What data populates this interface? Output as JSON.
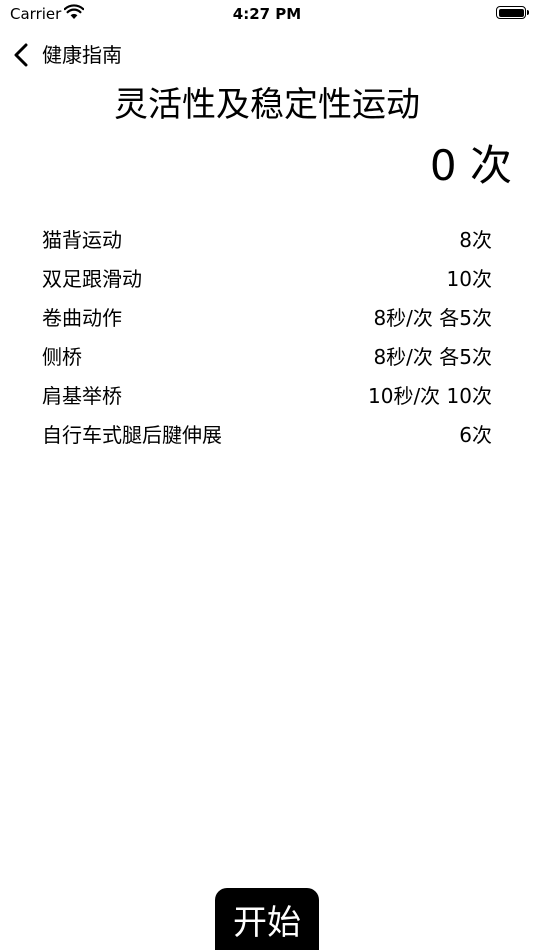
{
  "status_bar": {
    "carrier": "Carrier",
    "time": "4:27 PM",
    "battery_level": 1.0
  },
  "nav": {
    "back_label": "健康指南"
  },
  "title": "灵活性及稳定性运动",
  "count": "0 次",
  "exercises": [
    {
      "name": "猫背运动",
      "reps": "8次"
    },
    {
      "name": "双足跟滑动",
      "reps": "10次"
    },
    {
      "name": "卷曲动作",
      "reps": "8秒/次 各5次"
    },
    {
      "name": "侧桥",
      "reps": "8秒/次 各5次"
    },
    {
      "name": "肩基举桥",
      "reps": "10秒/次 10次"
    },
    {
      "name": "自行车式腿后腱伸展",
      "reps": "6次"
    }
  ],
  "start_button": {
    "label": "开始",
    "background": "#000000",
    "color": "#ffffff"
  }
}
